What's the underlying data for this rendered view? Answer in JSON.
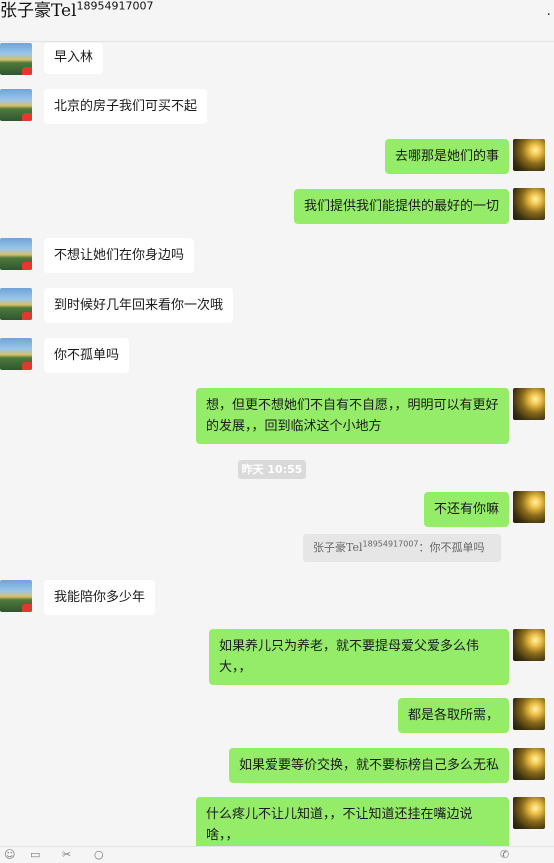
{
  "header": {
    "contact_name": "张子豪",
    "contact_tag": "Tel",
    "contact_number": "18954917007",
    "more_icon": "more-dots-icon"
  },
  "messages": [
    {
      "side": "in",
      "text": "早入林"
    },
    {
      "side": "in",
      "text": "北京的房子我们可买不起"
    },
    {
      "side": "out",
      "text": "去哪那是她们的事"
    },
    {
      "side": "out",
      "text": "我们提供我们能提供的最好的一切"
    },
    {
      "side": "in",
      "text": "不想让她们在你身边吗"
    },
    {
      "side": "in",
      "text": "到时候好几年回来看你一次哦"
    },
    {
      "side": "in",
      "text": "你不孤单吗"
    },
    {
      "side": "out",
      "text": "想，但更不想她们不自有不自愿，，明明可以有更好的发展，，回到临沭这个小地方"
    },
    {
      "side": "out",
      "text": "不还有你嘛"
    },
    {
      "side": "in",
      "text": "我能陪你多少年"
    },
    {
      "side": "out",
      "text": "如果养儿只为养老，就不要提母爱父爱多么伟大，，"
    },
    {
      "side": "out",
      "text": "都是各取所需，"
    },
    {
      "side": "out",
      "text": "如果爱要等价交换，就不要标榜自己多么无私"
    },
    {
      "side": "out",
      "text": "什么疼儿不让儿知道，，不让知道还挂在嘴边说啥，，"
    }
  ],
  "timestamp": "昨天 10:55",
  "quote": {
    "name": "张子豪",
    "tag": "Tel",
    "number": "18954917007",
    "text": "：你不孤单吗"
  },
  "avatars": {
    "contact": "landscape-avatar-icon",
    "self": "sunlight-avatar-icon"
  },
  "footer_icons": [
    "emoji-icon",
    "folder-icon",
    "scissors-icon",
    "chat-history-icon",
    "voice-call-icon"
  ]
}
